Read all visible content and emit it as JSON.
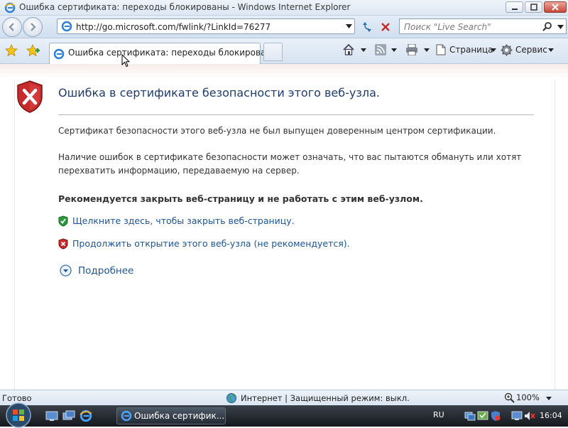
{
  "window": {
    "title": "Ошибка сертификата: переходы блокированы - Windows Internet Explorer"
  },
  "nav": {
    "address": "http://go.microsoft.com/fwlink/?LinkId=76277",
    "search_placeholder": "Поиск \"Live Search\""
  },
  "tabs": [
    {
      "label": "Ошибка сертификата: переходы блокированы",
      "active": true
    }
  ],
  "toolbar": {
    "page_label": "Страница",
    "tools_label": "Сервис"
  },
  "content": {
    "heading": "Ошибка в сертификате безопасности этого веб-узла.",
    "para1": "Сертификат безопасности этого веб-узла не был выпущен доверенным центром сертификации.",
    "para2": "Наличие ошибок в сертификате безопасности может означать, что вас пытаются обмануть или хотят перехватить информацию, передаваемую на сервер.",
    "recommendation": "Рекомендуется закрыть веб-страницу и не работать с этим веб-узлом.",
    "link_close": "Щелкните здесь, чтобы закрыть веб-страницу.",
    "link_continue": "Продолжить открытие этого веб-узла (не рекомендуется).",
    "more_info": "Подробнее"
  },
  "status": {
    "left": "Готово",
    "zone": "Интернет | Защищенный режим: выкл.",
    "zoom": "100%"
  },
  "taskbar": {
    "task_label": "Ошибка сертифик...",
    "language": "RU",
    "clock": "16:04"
  },
  "colors": {
    "link": "#1b5597",
    "heading": "#1e3c6e",
    "shield_red": "#c62a2a",
    "shield_green": "#2c9a3c"
  },
  "icons": [
    "ie-icon",
    "minimize-icon",
    "maximize-icon",
    "close-icon",
    "back-icon",
    "forward-icon",
    "refresh-icon",
    "stop-icon",
    "search-icon",
    "favorites-star-icon",
    "add-favorites-icon",
    "home-icon",
    "rss-icon",
    "print-icon",
    "page-icon",
    "tools-gear-icon",
    "shield-error-icon",
    "shield-ok-icon",
    "shield-warn-icon",
    "expand-circle-icon",
    "globe-icon",
    "zoom-icon",
    "windows-start-icon"
  ]
}
